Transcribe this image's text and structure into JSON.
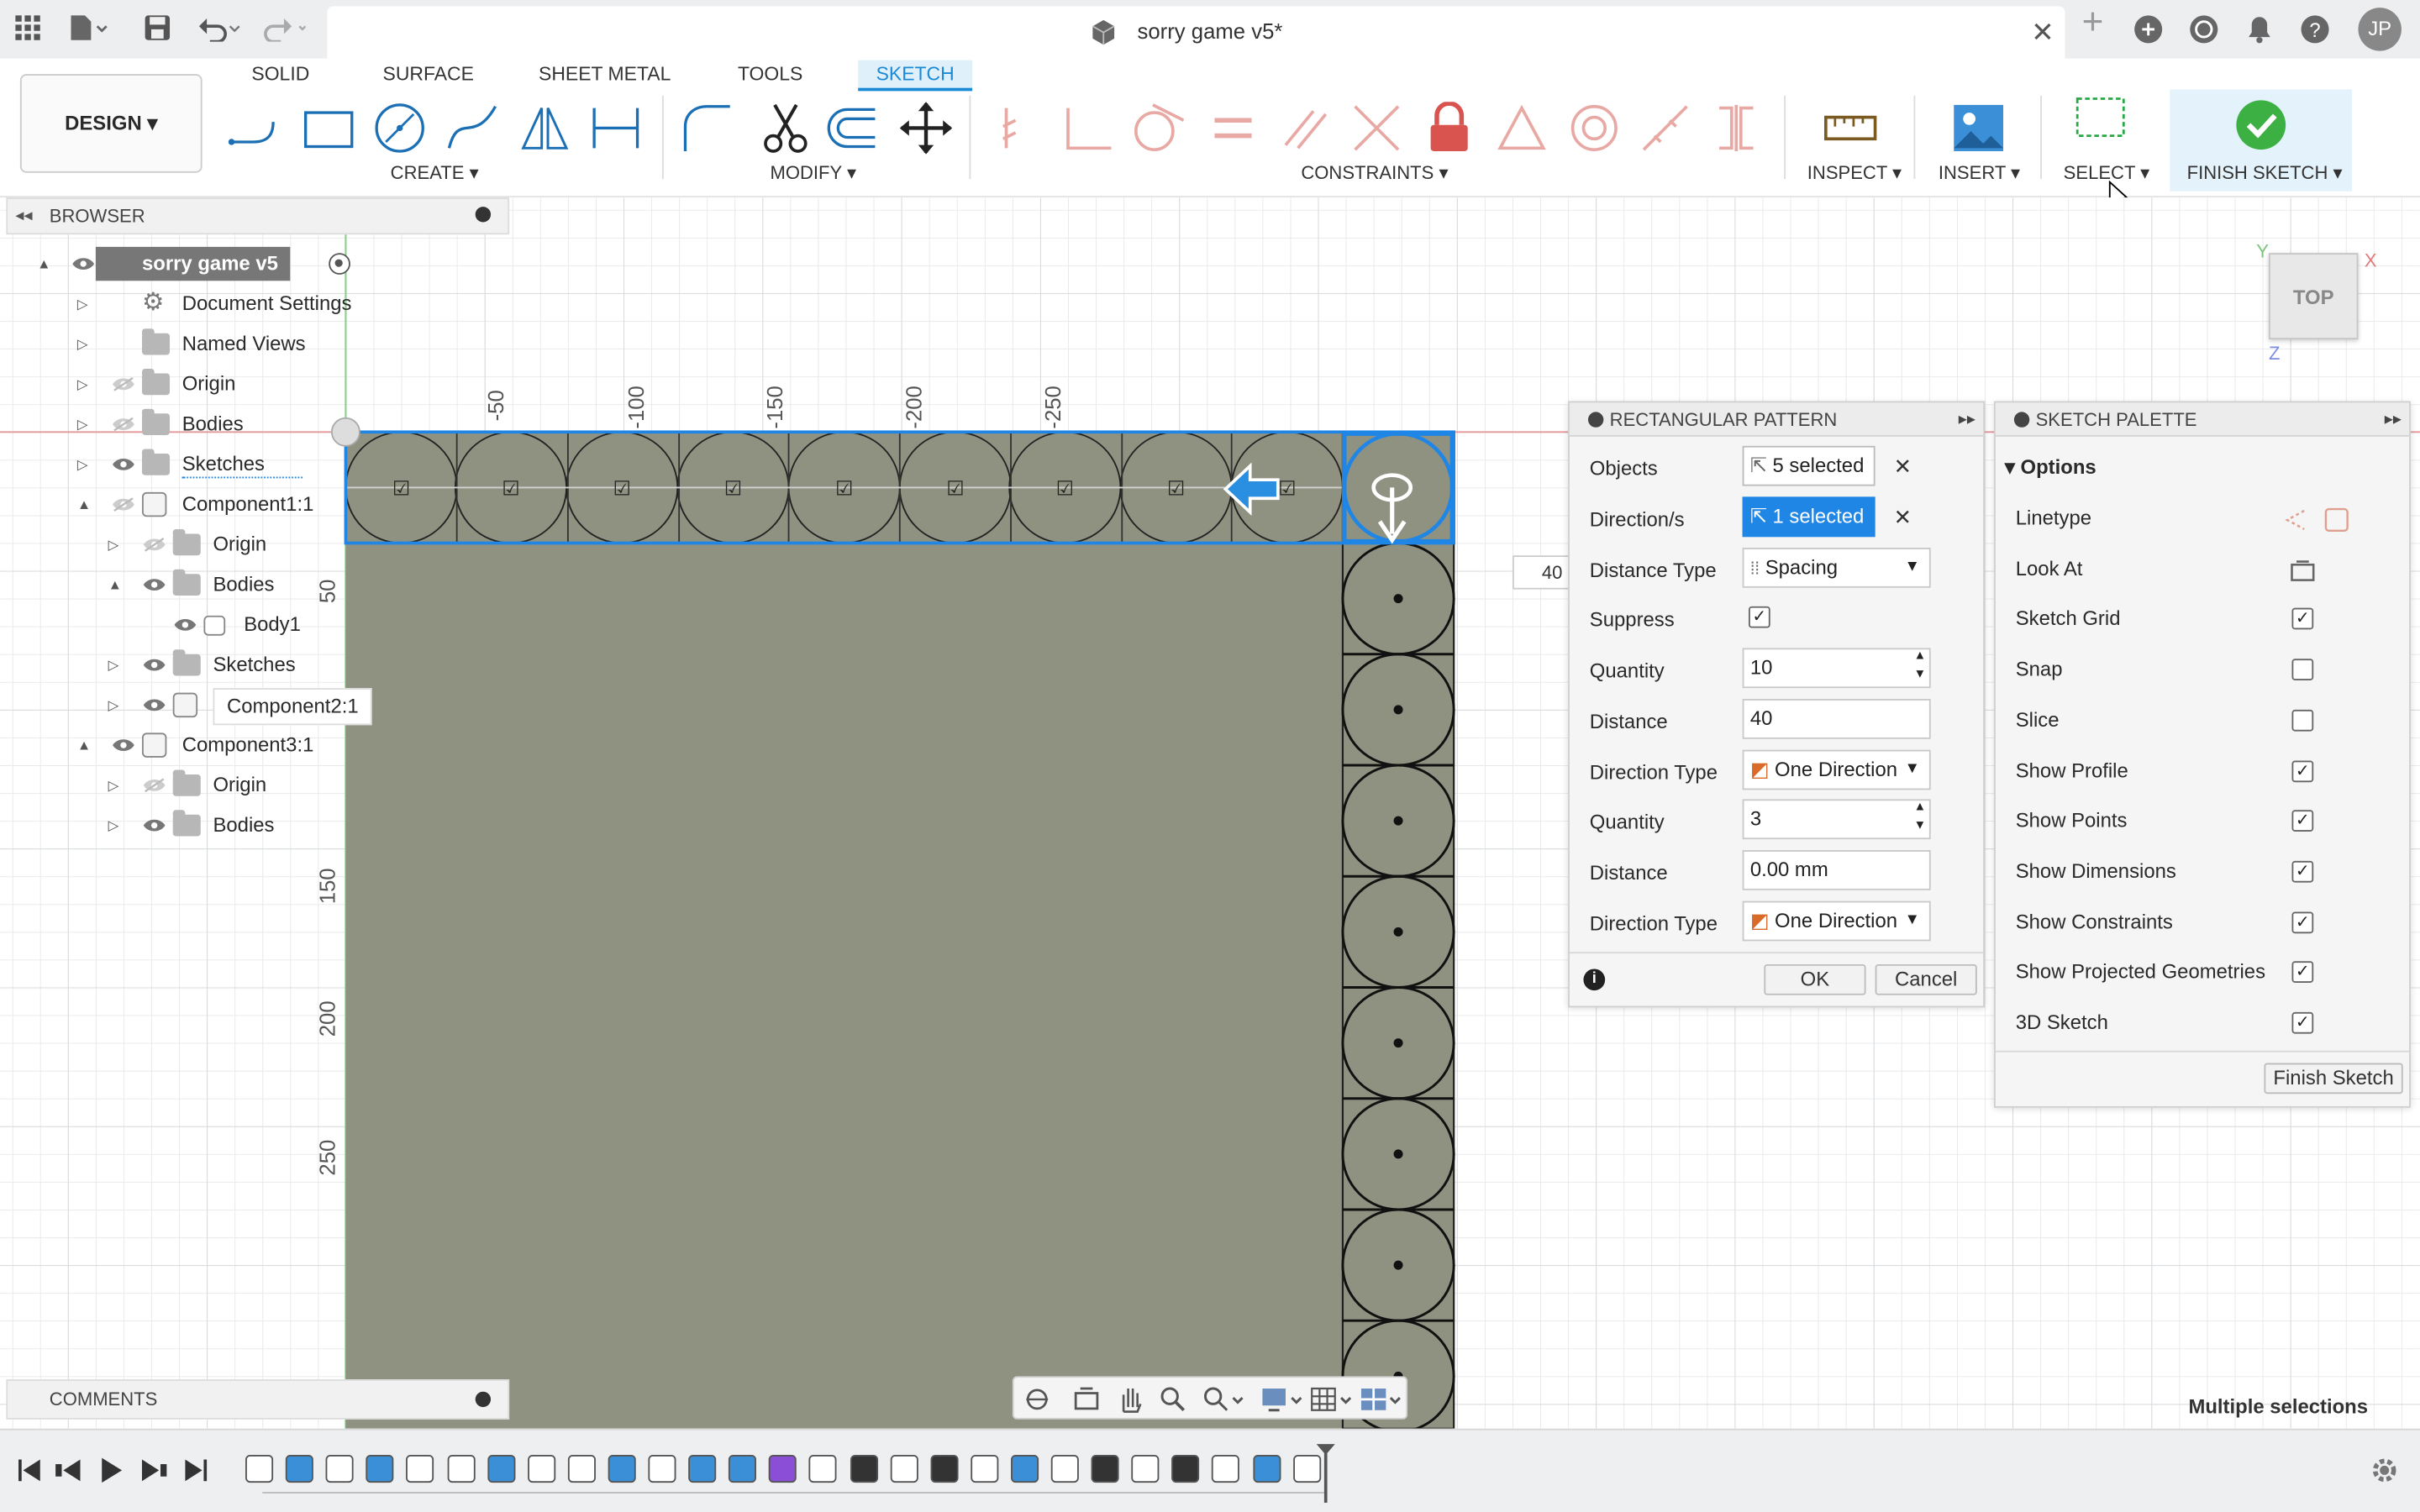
{
  "app": {
    "doc_title": "sorry game v5*",
    "user_initials": "JP"
  },
  "ribbon": {
    "tabs": [
      "SOLID",
      "SURFACE",
      "SHEET METAL",
      "TOOLS",
      "SKETCH"
    ],
    "active_tab": "SKETCH",
    "design_label": "DESIGN",
    "groups": {
      "create": "CREATE",
      "modify": "MODIFY",
      "constraints": "CONSTRAINTS",
      "inspect": "INSPECT",
      "insert": "INSERT",
      "select": "SELECT",
      "finish": "FINISH SKETCH"
    }
  },
  "browser": {
    "title": "BROWSER",
    "items": [
      {
        "label": "sorry game v5",
        "level": 0
      },
      {
        "label": "Document Settings",
        "level": 1
      },
      {
        "label": "Named Views",
        "level": 1
      },
      {
        "label": "Origin",
        "level": 1
      },
      {
        "label": "Bodies",
        "level": 1
      },
      {
        "label": "Sketches",
        "level": 1
      },
      {
        "label": "Component1:1",
        "level": 1
      },
      {
        "label": "Origin",
        "level": 2
      },
      {
        "label": "Bodies",
        "level": 2
      },
      {
        "label": "Body1",
        "level": 3
      },
      {
        "label": "Sketches",
        "level": 2
      },
      {
        "label": "Component2:1",
        "level": 2
      },
      {
        "label": "Component3:1",
        "level": 1
      },
      {
        "label": "Origin",
        "level": 2
      },
      {
        "label": "Bodies",
        "level": 2
      }
    ]
  },
  "comments": {
    "title": "COMMENTS"
  },
  "viewcube": {
    "face": "TOP",
    "x_axis": "X",
    "y_axis": "Y",
    "z_axis": "Z"
  },
  "rulers": {
    "top": [
      "-50",
      "-100",
      "-150",
      "-200",
      "-250"
    ],
    "left": [
      "50",
      "100",
      "150",
      "200",
      "250"
    ]
  },
  "dimension_input": "40",
  "rect_pattern": {
    "title": "RECTANGULAR PATTERN",
    "rows": [
      {
        "label": "Objects",
        "value": "5 selected"
      },
      {
        "label": "Direction/s",
        "value": "1 selected"
      },
      {
        "label": "Distance Type",
        "value": "Spacing"
      },
      {
        "label": "Suppress",
        "value": ""
      },
      {
        "label": "Quantity",
        "value": "10"
      },
      {
        "label": "Distance",
        "value": "40"
      },
      {
        "label": "Direction Type",
        "value": "One Direction"
      },
      {
        "label": "Quantity",
        "value": "3"
      },
      {
        "label": "Distance",
        "value": "0.00 mm"
      },
      {
        "label": "Direction Type",
        "value": "One Direction"
      }
    ],
    "ok": "OK",
    "cancel": "Cancel"
  },
  "sketch_palette": {
    "title": "SKETCH PALETTE",
    "section": "Options",
    "options": [
      {
        "label": "Linetype"
      },
      {
        "label": "Look At"
      },
      {
        "label": "Sketch Grid",
        "checked": true
      },
      {
        "label": "Snap",
        "checked": false
      },
      {
        "label": "Slice",
        "checked": false
      },
      {
        "label": "Show Profile",
        "checked": true
      },
      {
        "label": "Show Points",
        "checked": true
      },
      {
        "label": "Show Dimensions",
        "checked": true
      },
      {
        "label": "Show Constraints",
        "checked": true
      },
      {
        "label": "Show Projected Geometries",
        "checked": true
      },
      {
        "label": "3D Sketch",
        "checked": true
      }
    ],
    "finish_label": "Finish Sketch"
  },
  "status": {
    "text": "Multiple selections"
  },
  "colors": {
    "accent": "#1a8ad6",
    "sketch_fill": "#8f9280",
    "selection": "#1f86e6",
    "finish_green": "#3cb043"
  }
}
